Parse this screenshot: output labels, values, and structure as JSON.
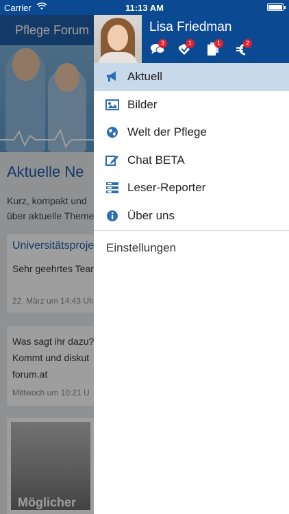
{
  "status_bar": {
    "carrier": "Carrier",
    "time": "11:13 AM"
  },
  "main": {
    "nav_title": "Pflege Forum",
    "section_title": "Aktuelle Ne",
    "intro_lines": [
      "Kurz, kompakt und",
      "über aktuelle Theme"
    ],
    "cards": [
      {
        "title": "Universitätsproje",
        "body": [
          "Sehr geehrtes Tear"
        ],
        "date": "22. März um 14:43 Uh"
      },
      {
        "title": "",
        "body": [
          "Was sagt ihr dazu?",
          "Kommt und diskut",
          "forum.at"
        ],
        "date": "Mittwoch um 10:21 U"
      }
    ],
    "image_caption": "Möglicher"
  },
  "drawer": {
    "user_name": "Lisa Friedman",
    "badges": [
      {
        "icon": "chat-icon",
        "count": "3"
      },
      {
        "icon": "tag-icon",
        "count": "1"
      },
      {
        "icon": "documents-icon",
        "count": "1"
      },
      {
        "icon": "euro-icon",
        "count": "2"
      }
    ],
    "menu": [
      {
        "icon": "megaphone-icon",
        "label": "Aktuell",
        "active": true
      },
      {
        "icon": "image-icon",
        "label": "Bilder",
        "active": false
      },
      {
        "icon": "globe-icon",
        "label": "Welt der Pflege",
        "active": false
      },
      {
        "icon": "edit-icon",
        "label": "Chat BETA",
        "active": false
      },
      {
        "icon": "news-icon",
        "label": "Leser-Reporter",
        "active": false
      },
      {
        "icon": "info-icon",
        "label": "Über uns",
        "active": false
      }
    ],
    "settings_label": "Einstellungen"
  },
  "colors": {
    "brand_blue": "#0b4a93",
    "active_row": "#c8d9ea",
    "badge_red": "#e0212b",
    "icon_blue": "#2f6db5"
  }
}
